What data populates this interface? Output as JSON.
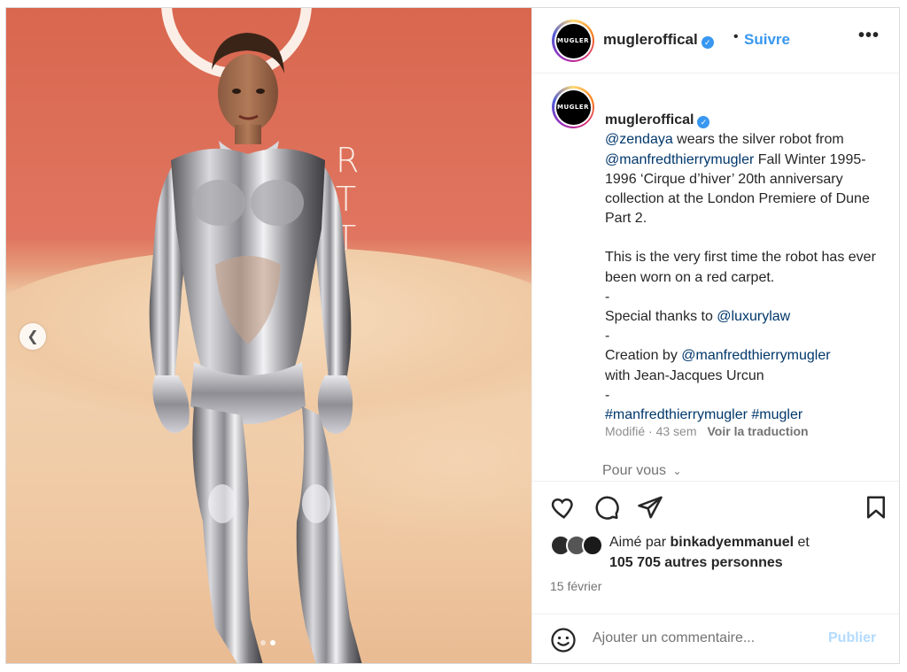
{
  "post": {
    "username": "mugleroffical",
    "avatar_text": "MUGLER",
    "follow_label": "Suivre",
    "separator": "•",
    "more_label": "•••"
  },
  "caption": {
    "username": "mugleroffical",
    "mention1": "@zendaya",
    "text1": " wears the silver robot from ",
    "mention2": "@manfredthierrymugler",
    "text2": " Fall Winter 1995-1996 ‘Cirque d’hiver’ 20th anniversary collection at the London Premiere of Dune Part 2.",
    "text3": "This is the very first time the robot has ever been worn on a red carpet.\n-\nSpecial thanks to ",
    "mention3": "@luxurylaw",
    "text4": "-\nCreation by ",
    "mention4": "@manfredthierrymugler",
    "text5": "with Jean-Jacques Urcun\n-",
    "hashtags": "#manfredthierrymugler #mugler",
    "meta": "Modifié · 43 sem",
    "translate_label": "Voir la traduction"
  },
  "for_you_label": "Pour vous",
  "likes": {
    "prefix": "Aimé par ",
    "user": "binkadyemmanuel",
    "suffix": " et",
    "others": "105 705 autres personnes"
  },
  "date": "15 février",
  "comment": {
    "placeholder": "Ajouter un commentaire...",
    "publish_label": "Publier"
  },
  "photo": {
    "backdrop_letters": "R T T"
  },
  "carousel": {
    "prev_icon": "chevron-left-icon",
    "slide_count": 2,
    "active_slide": 2
  },
  "colors": {
    "accent": "#3897f0",
    "link": "#00376b",
    "muted": "#737373"
  }
}
